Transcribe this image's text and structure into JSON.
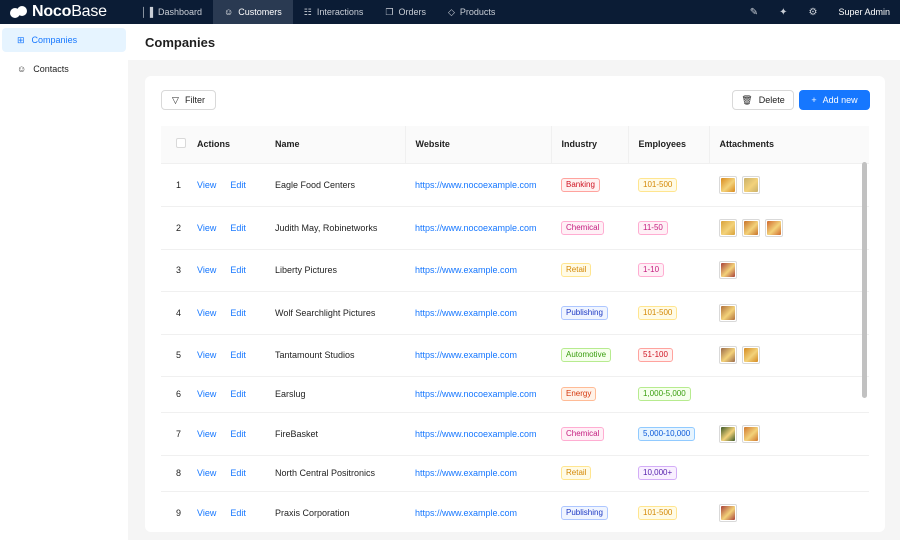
{
  "app": {
    "brand_bold": "Noco",
    "brand_light": "Base"
  },
  "topnav": {
    "items": [
      {
        "label": "Dashboard",
        "icon": "bar-chart-icon",
        "glyph": "│▐",
        "active": false
      },
      {
        "label": "Customers",
        "icon": "users-icon",
        "glyph": "☺",
        "active": true
      },
      {
        "label": "Interactions",
        "icon": "interactions-icon",
        "glyph": "☷",
        "active": false
      },
      {
        "label": "Orders",
        "icon": "cart-icon",
        "glyph": "❒",
        "active": false
      },
      {
        "label": "Products",
        "icon": "tag-icon",
        "glyph": "◇",
        "active": false
      }
    ],
    "user": "Super Admin"
  },
  "sidebar": {
    "items": [
      {
        "label": "Companies",
        "icon": "table-icon",
        "active": true
      },
      {
        "label": "Contacts",
        "icon": "users-icon",
        "active": false
      }
    ]
  },
  "page": {
    "title": "Companies"
  },
  "toolbar": {
    "filter_label": "Filter",
    "delete_label": "Delete",
    "add_label": "Add new"
  },
  "table": {
    "columns": [
      "Actions",
      "Name",
      "Website",
      "Industry",
      "Employees",
      "Attachments"
    ],
    "view_label": "View",
    "edit_label": "Edit",
    "rows": [
      {
        "num": "1",
        "name": "Eagle Food Centers",
        "website": "https://www.nocoexample.com",
        "industry": "Banking",
        "employees": "101-500",
        "attachments": [
          "#d98a1e",
          "#c9b06a"
        ]
      },
      {
        "num": "2",
        "name": "Judith May, Robinetworks",
        "website": "https://www.nocoexample.com",
        "industry": "Chemical",
        "employees": "11-50",
        "attachments": [
          "#d9a23a",
          "#c7722a",
          "#d06a2e"
        ]
      },
      {
        "num": "3",
        "name": "Liberty Pictures",
        "website": "https://www.example.com",
        "industry": "Retail",
        "employees": "1-10",
        "attachments": [
          "#a8423a"
        ]
      },
      {
        "num": "4",
        "name": "Wolf Searchlight Pictures",
        "website": "https://www.example.com",
        "industry": "Publishing",
        "employees": "101-500",
        "attachments": [
          "#b0703c"
        ]
      },
      {
        "num": "5",
        "name": "Tantamount Studios",
        "website": "https://www.example.com",
        "industry": "Automotive",
        "employees": "51-100",
        "attachments": [
          "#9a6a4a",
          "#d48a22"
        ]
      },
      {
        "num": "6",
        "name": "Earslug",
        "website": "https://www.nocoexample.com",
        "industry": "Energy",
        "employees": "1,000-5,000",
        "attachments": []
      },
      {
        "num": "7",
        "name": "FireBasket",
        "website": "https://www.nocoexample.com",
        "industry": "Chemical",
        "employees": "5,000-10,000",
        "attachments": [
          "#3e5a2a",
          "#d0782e"
        ]
      },
      {
        "num": "8",
        "name": "North Central Positronics",
        "website": "https://www.example.com",
        "industry": "Retail",
        "employees": "10,000+",
        "attachments": []
      },
      {
        "num": "9",
        "name": "Praxis Corporation",
        "website": "https://www.example.com",
        "industry": "Publishing",
        "employees": "101-500",
        "attachments": [
          "#a8423a"
        ]
      }
    ]
  },
  "colors": {
    "accent": "#1677ff",
    "topbar": "#0b1c35",
    "tags": {
      "Banking": {
        "fg": "#cf1322",
        "bg": "#fff1f0",
        "bd": "#ffa39e"
      },
      "Chemical": {
        "fg": "#c41d7f",
        "bg": "#fff0f6",
        "bd": "#ffadd2"
      },
      "Retail": {
        "fg": "#d48806",
        "bg": "#fffbe6",
        "bd": "#ffe58f"
      },
      "Publishing": {
        "fg": "#1d39c4",
        "bg": "#f0f5ff",
        "bd": "#adc6ff"
      },
      "Automotive": {
        "fg": "#389e0d",
        "bg": "#f6ffed",
        "bd": "#b7eb8f"
      },
      "Energy": {
        "fg": "#d4380d",
        "bg": "#fff2e8",
        "bd": "#ffbb96"
      },
      "101-500": {
        "fg": "#d48806",
        "bg": "#fffbe6",
        "bd": "#ffe58f"
      },
      "11-50": {
        "fg": "#c41d7f",
        "bg": "#fff0f6",
        "bd": "#ffadd2"
      },
      "1-10": {
        "fg": "#c41d7f",
        "bg": "#fff0f6",
        "bd": "#ffadd2"
      },
      "51-100": {
        "fg": "#cf1322",
        "bg": "#fff1f0",
        "bd": "#ffa39e"
      },
      "1,000-5,000": {
        "fg": "#389e0d",
        "bg": "#f6ffed",
        "bd": "#b7eb8f"
      },
      "5,000-10,000": {
        "fg": "#0958d9",
        "bg": "#e6f4ff",
        "bd": "#91caff"
      },
      "10,000+": {
        "fg": "#531dab",
        "bg": "#f9f0ff",
        "bd": "#d3adf7"
      }
    }
  }
}
